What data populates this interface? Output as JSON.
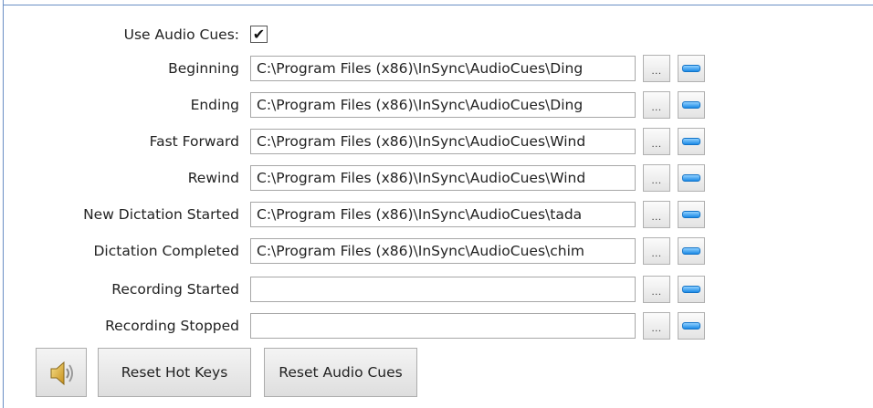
{
  "use_audio_cues": {
    "label": "Use Audio Cues:",
    "checked": true,
    "check_glyph": "✔"
  },
  "rows": [
    {
      "label": "Beginning",
      "path": "C:\\Program Files (x86)\\InSync\\AudioCues\\Ding"
    },
    {
      "label": "Ending",
      "path": "C:\\Program Files (x86)\\InSync\\AudioCues\\Ding"
    },
    {
      "label": "Fast Forward",
      "path": "C:\\Program Files (x86)\\InSync\\AudioCues\\Wind"
    },
    {
      "label": "Rewind",
      "path": "C:\\Program Files (x86)\\InSync\\AudioCues\\Wind"
    },
    {
      "label": "New Dictation Started",
      "path": "C:\\Program Files (x86)\\InSync\\AudioCues\\tada"
    },
    {
      "label": "Dictation Completed",
      "path": "C:\\Program Files (x86)\\InSync\\AudioCues\\chim"
    },
    {
      "label": "Recording Started",
      "path": ""
    },
    {
      "label": "Recording Stopped",
      "path": ""
    }
  ],
  "browse_label": "...",
  "play_icon": "play-sound-icon",
  "buttons": {
    "speaker_icon": "speaker-icon",
    "reset_hot_keys": "Reset Hot Keys",
    "reset_audio_cues": "Reset Audio Cues"
  },
  "colors": {
    "accent": "#1c8ae6",
    "frame": "#6a8fc4"
  }
}
